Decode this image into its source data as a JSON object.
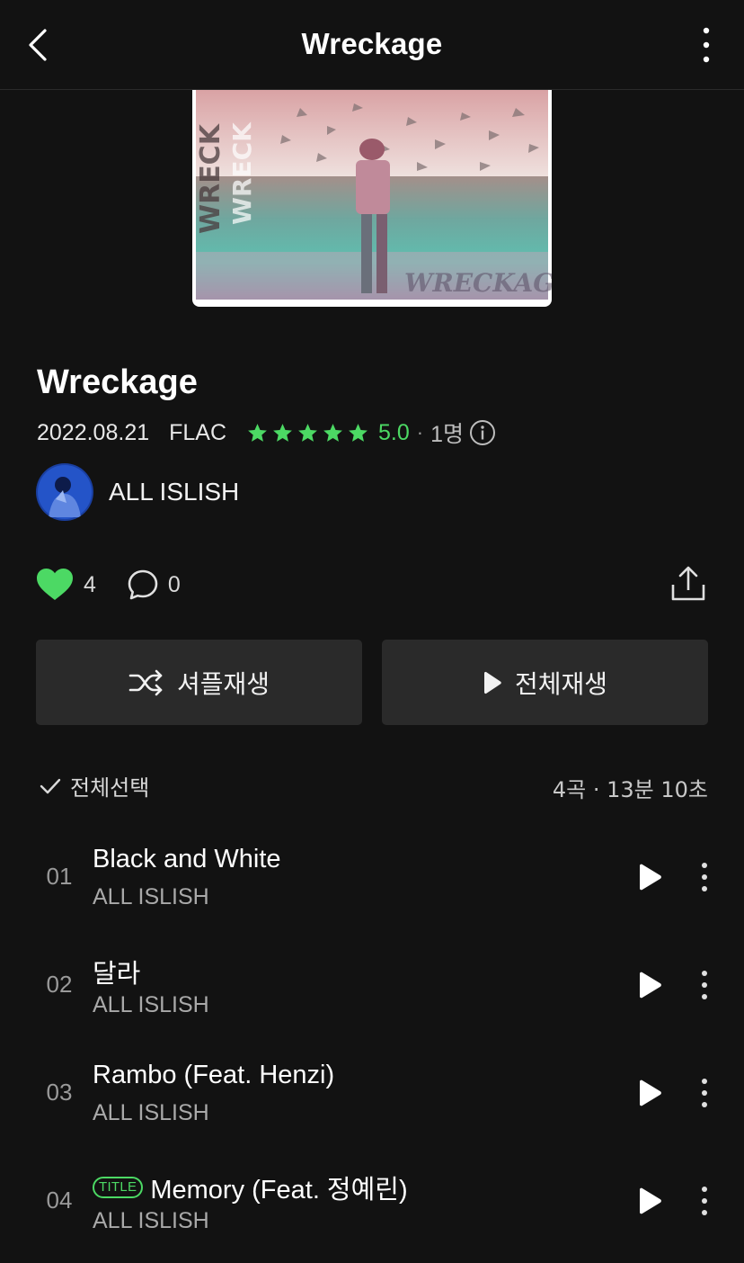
{
  "header": {
    "title": "Wreckage"
  },
  "album": {
    "title": "Wreckage",
    "release_date": "2022.08.21",
    "format": "FLAC",
    "stars_filled": 5,
    "rating": "5.0",
    "separator": "·",
    "raters": "1명"
  },
  "artist": {
    "name": "ALL ISLISH"
  },
  "social": {
    "likes": "4",
    "comments": "0"
  },
  "buttons": {
    "shuffle": "셔플재생",
    "play_all": "전체재생"
  },
  "list": {
    "select_all": "전체선택",
    "summary": "4곡 · 13분 10초"
  },
  "tracks": [
    {
      "num": "01",
      "title": "Black and White",
      "artist": "ALL ISLISH",
      "badge": ""
    },
    {
      "num": "02",
      "title": "달라",
      "artist": "ALL ISLISH",
      "badge": ""
    },
    {
      "num": "03",
      "title": "Rambo (Feat. Henzi)",
      "artist": "ALL ISLISH",
      "badge": ""
    },
    {
      "num": "04",
      "title": "Memory (Feat. 정예린)",
      "artist": "ALL ISLISH",
      "badge": "TITLE"
    }
  ],
  "colors": {
    "accent": "#4cd964",
    "background": "#121212",
    "button": "#2a2a2a"
  }
}
